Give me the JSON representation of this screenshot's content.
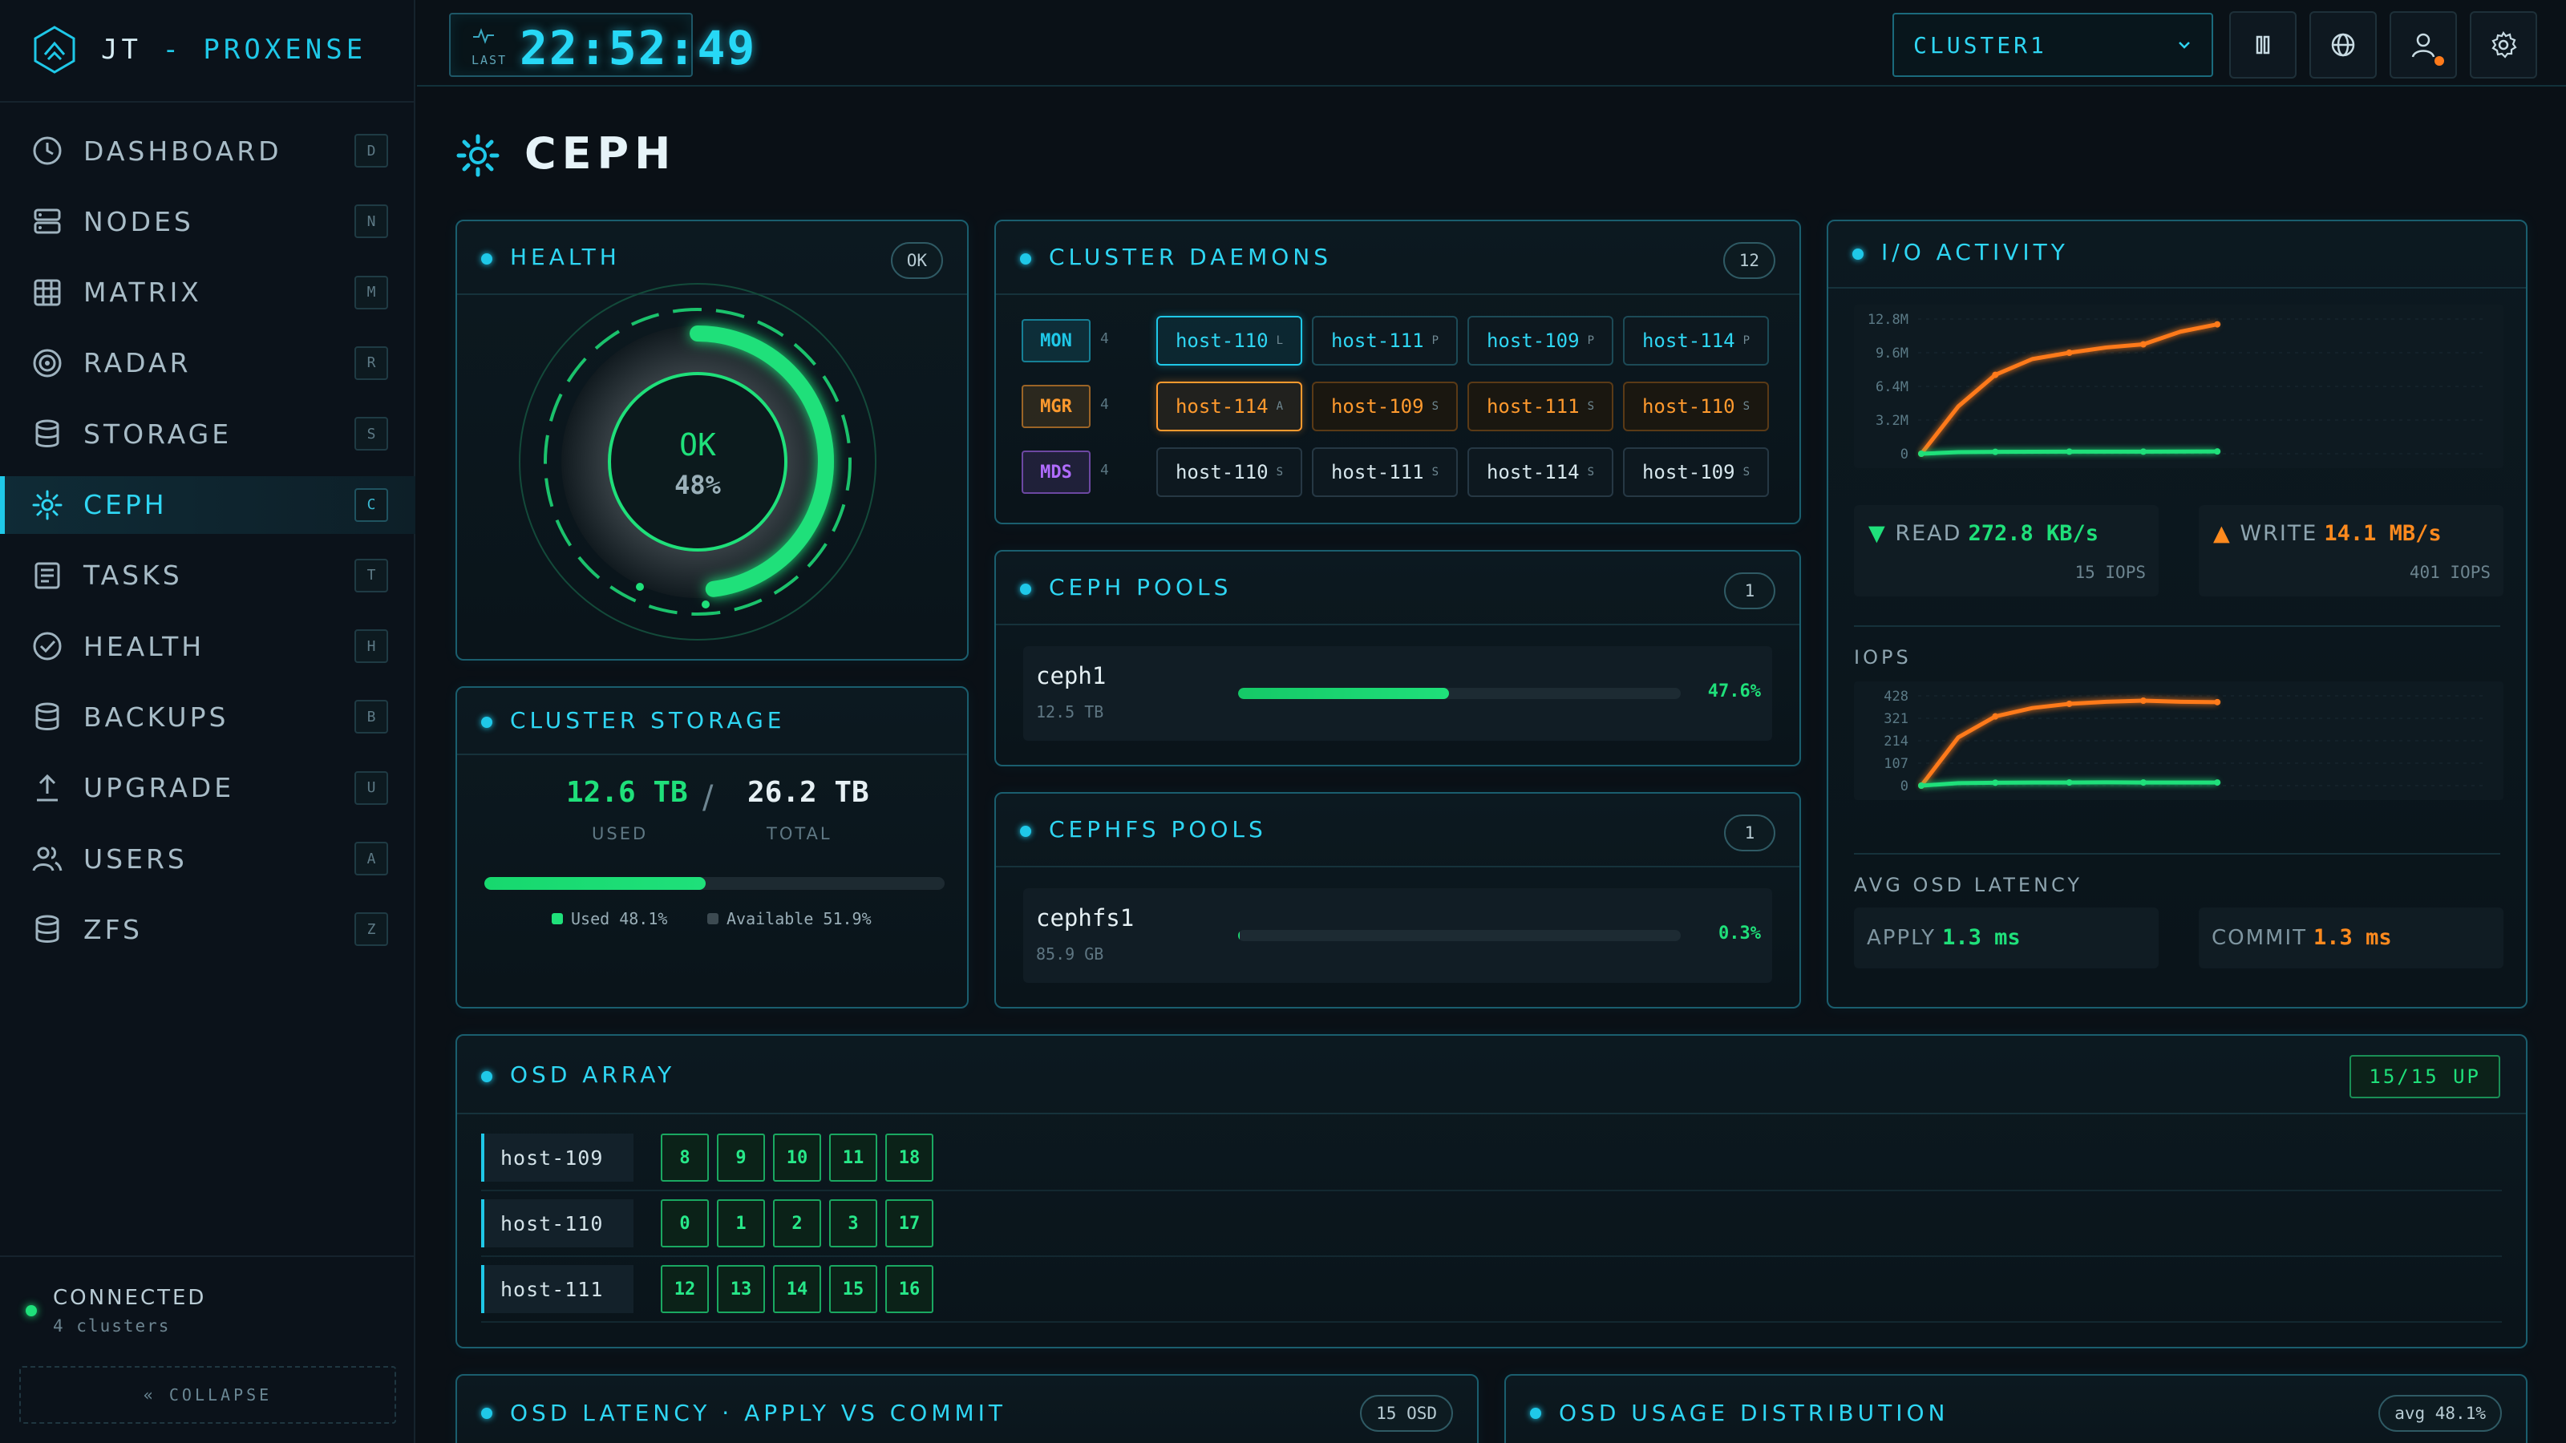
{
  "brand": {
    "prefix": "JT",
    "separator": "-",
    "name": "PROXENSE"
  },
  "nav": [
    {
      "label": "DASHBOARD",
      "key": "D",
      "icon": "clock-icon"
    },
    {
      "label": "NODES",
      "key": "N",
      "icon": "server-icon"
    },
    {
      "label": "MATRIX",
      "key": "M",
      "icon": "grid-icon"
    },
    {
      "label": "RADAR",
      "key": "R",
      "icon": "radar-icon"
    },
    {
      "label": "STORAGE",
      "key": "S",
      "icon": "database-icon"
    },
    {
      "label": "CEPH",
      "key": "C",
      "icon": "ceph-icon",
      "active": true
    },
    {
      "label": "TASKS",
      "key": "T",
      "icon": "tasks-icon"
    },
    {
      "label": "HEALTH",
      "key": "H",
      "icon": "check-circle-icon"
    },
    {
      "label": "BACKUPS",
      "key": "B",
      "icon": "database-icon"
    },
    {
      "label": "UPGRADE",
      "key": "U",
      "icon": "upload-icon"
    },
    {
      "label": "USERS",
      "key": "A",
      "icon": "users-icon"
    },
    {
      "label": "ZFS",
      "key": "Z",
      "icon": "database-icon"
    }
  ],
  "connection": {
    "status": "CONNECTED",
    "sub": "4 clusters"
  },
  "collapse_label": "« COLLAPSE",
  "topbar": {
    "clock_label": "LAST",
    "clock_time": "22:52:49",
    "cluster": "CLUSTER1"
  },
  "page": {
    "title": "CEPH"
  },
  "health": {
    "title": "HEALTH",
    "badge": "OK",
    "status": "OK",
    "percent": "48%",
    "fill": 0.48
  },
  "storage": {
    "title": "CLUSTER STORAGE",
    "used": "12.6 TB",
    "used_label": "USED",
    "total": "26.2 TB",
    "total_label": "TOTAL",
    "separator": "/",
    "used_fraction": 0.481,
    "legend_used": "Used 48.1%",
    "legend_available": "Available 51.9%"
  },
  "daemons": {
    "title": "CLUSTER DAEMONS",
    "badge": "12",
    "rows": [
      {
        "role": "MON",
        "count": "4",
        "color": "#1fc8e8",
        "chips": [
          {
            "host": "host-110",
            "flag": "L",
            "active": true
          },
          {
            "host": "host-111",
            "flag": "P"
          },
          {
            "host": "host-109",
            "flag": "P"
          },
          {
            "host": "host-114",
            "flag": "P"
          }
        ]
      },
      {
        "role": "MGR",
        "count": "4",
        "color": "#ff9a2e",
        "chips": [
          {
            "host": "host-114",
            "flag": "A",
            "active": true
          },
          {
            "host": "host-109",
            "flag": "S"
          },
          {
            "host": "host-111",
            "flag": "S"
          },
          {
            "host": "host-110",
            "flag": "S"
          }
        ]
      },
      {
        "role": "MDS",
        "count": "4",
        "color": "#b06cff",
        "chips": [
          {
            "host": "host-110",
            "flag": "S"
          },
          {
            "host": "host-111",
            "flag": "S"
          },
          {
            "host": "host-114",
            "flag": "S"
          },
          {
            "host": "host-109",
            "flag": "S"
          }
        ]
      }
    ]
  },
  "pools": {
    "title": "CEPH POOLS",
    "badge": "1",
    "name": "ceph1",
    "size": "12.5 TB",
    "percent": "47.6%",
    "fraction": 0.476
  },
  "cephfs": {
    "title": "CEPHFS POOLS",
    "badge": "1",
    "name": "cephfs1",
    "size": "85.9 GB",
    "percent": "0.3%",
    "fraction": 0.003
  },
  "io": {
    "title": "I/O ACTIVITY",
    "read_label": "READ",
    "read_value": "272.8 KB/s",
    "read_iops": "15 IOPS",
    "write_label": "WRITE",
    "write_value": "14.1 MB/s",
    "write_iops": "401 IOPS",
    "iops_label": "IOPS",
    "latency_label": "AVG OSD LATENCY",
    "apply_label": "APPLY",
    "apply_value": "1.3 ms",
    "commit_label": "COMMIT",
    "commit_value": "1.3 ms"
  },
  "chart_data": [
    {
      "type": "line",
      "title": "",
      "y_ticks": [
        "12.8M",
        "9.6M",
        "6.4M",
        "3.2M",
        "0"
      ],
      "ylim": [
        0,
        12800000
      ],
      "series": [
        {
          "color": "#ff7a1a",
          "values": [
            0,
            4500000,
            7500000,
            9000000,
            9600000,
            10100000,
            10400000,
            11600000,
            12300000
          ]
        },
        {
          "color": "#1fe07a",
          "values": [
            0,
            150000,
            180000,
            190000,
            200000,
            200000,
            200000,
            210000,
            220000
          ]
        }
      ]
    },
    {
      "type": "line",
      "title": "",
      "y_ticks": [
        "428",
        "321",
        "214",
        "107",
        "0"
      ],
      "ylim": [
        0,
        428
      ],
      "series": [
        {
          "color": "#ff7a1a",
          "values": [
            0,
            230,
            330,
            370,
            390,
            400,
            405,
            400,
            398
          ]
        },
        {
          "color": "#1fe07a",
          "values": [
            0,
            12,
            14,
            15,
            15,
            16,
            15,
            15,
            15
          ]
        }
      ]
    }
  ],
  "osd": {
    "title": "OSD ARRAY",
    "badge": "15/15 UP",
    "hosts": [
      {
        "name": "host-109",
        "osds": [
          "8",
          "9",
          "10",
          "11",
          "18"
        ]
      },
      {
        "name": "host-110",
        "osds": [
          "0",
          "1",
          "2",
          "3",
          "17"
        ]
      },
      {
        "name": "host-111",
        "osds": [
          "12",
          "13",
          "14",
          "15",
          "16"
        ]
      }
    ]
  },
  "latency_panel": {
    "title": "OSD LATENCY · APPLY VS COMMIT",
    "badge": "15 OSD"
  },
  "usage_panel": {
    "title": "OSD USAGE DISTRIBUTION",
    "badge": "avg 48.1%"
  }
}
